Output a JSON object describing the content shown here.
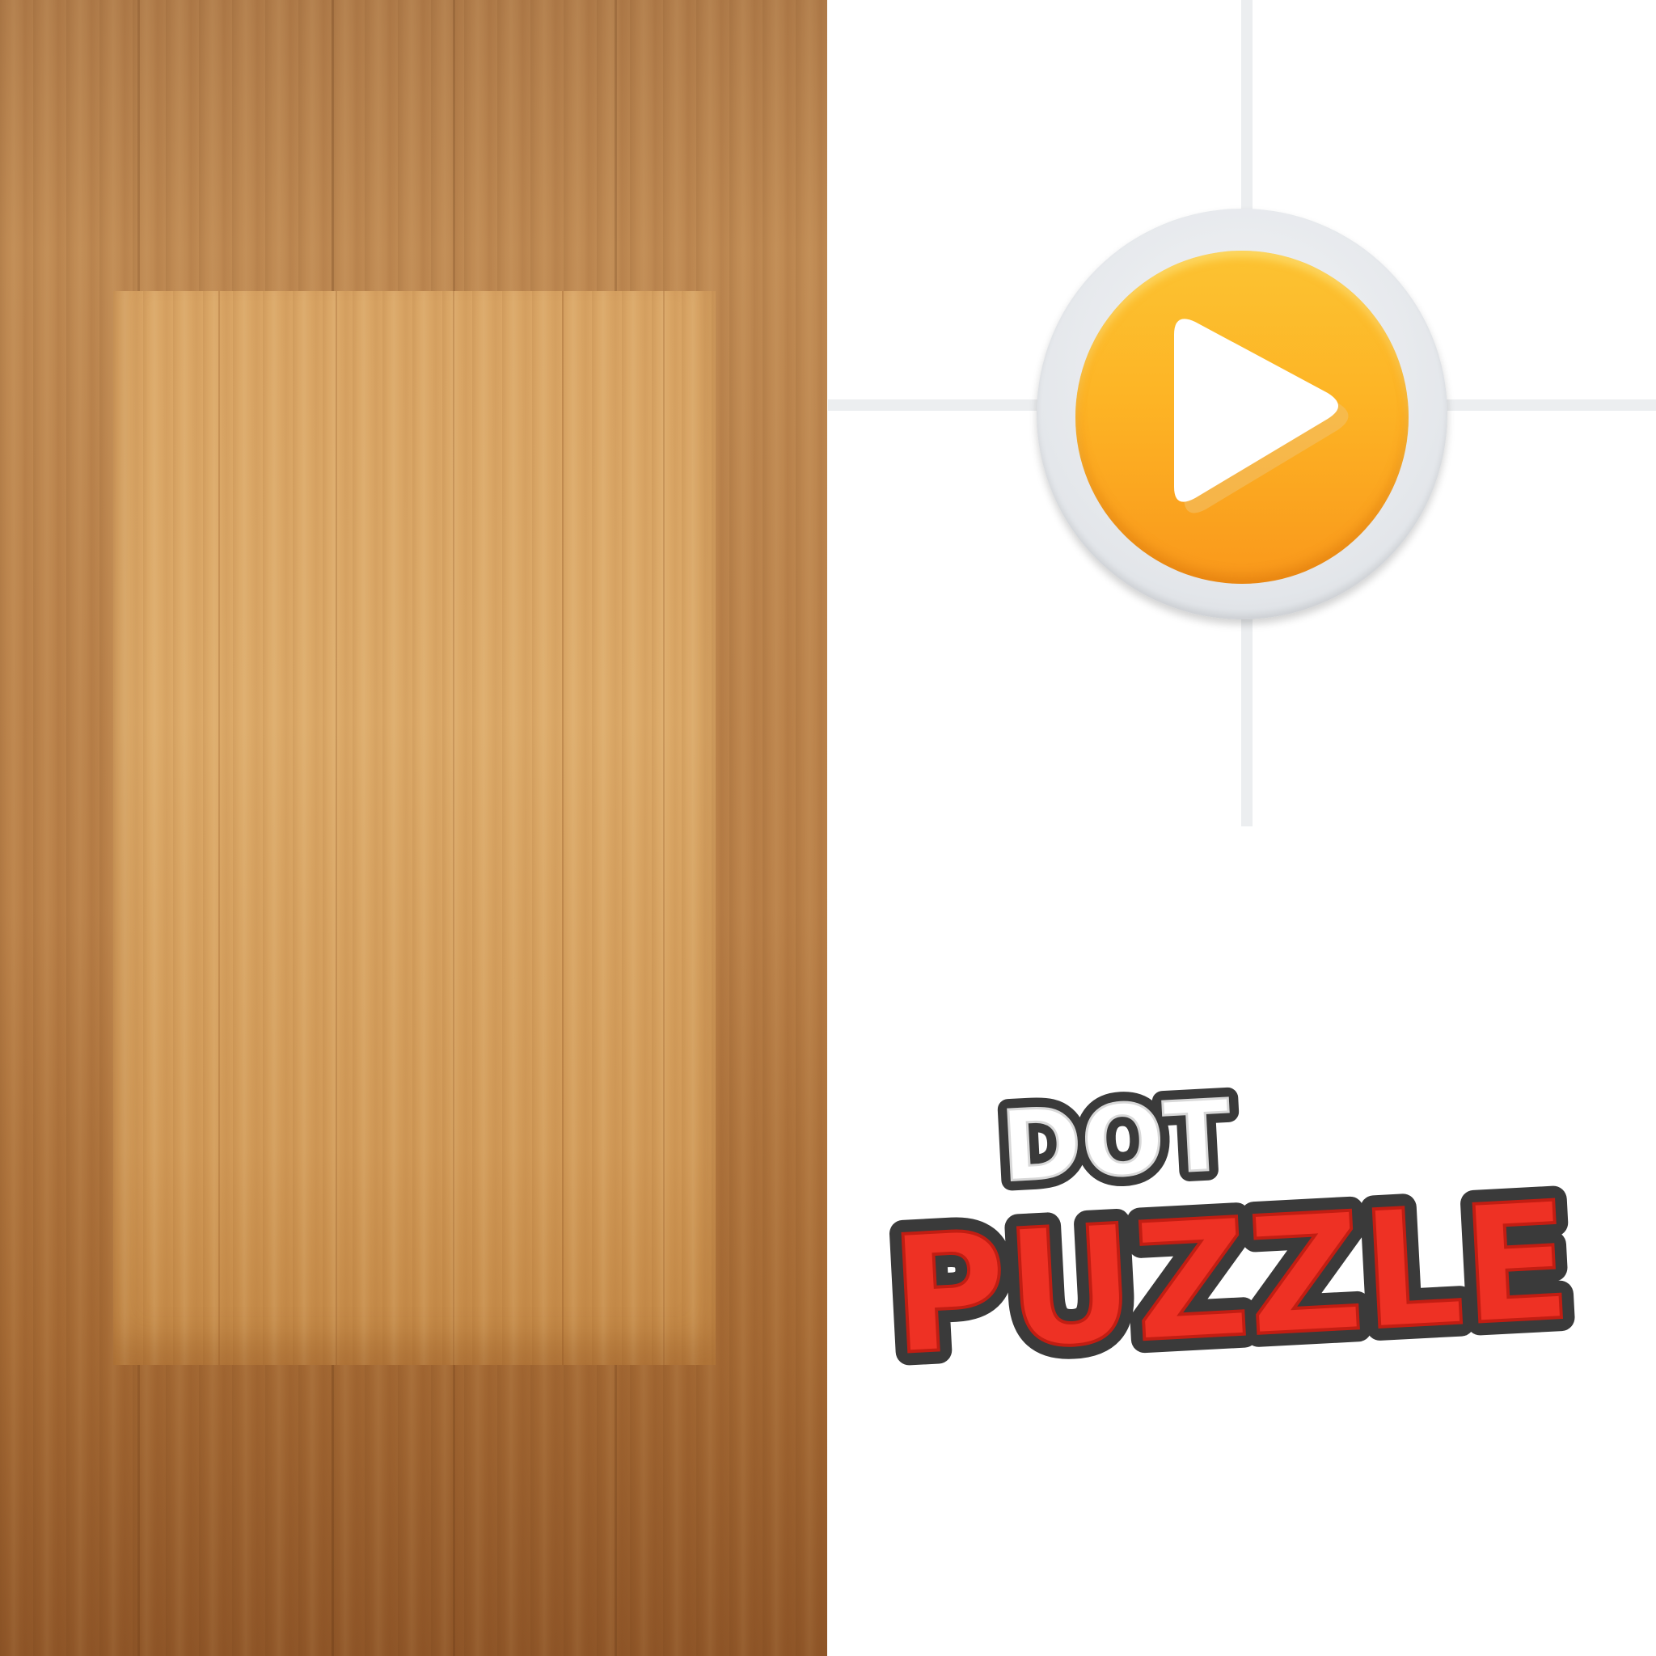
{
  "logo": {
    "line1": "DOT",
    "line2": "PUZZLE"
  },
  "play_button": {
    "icon": "play-icon"
  },
  "colors": {
    "wood_dark": "#a66b35",
    "wood_light": "#dcaa69",
    "grid_line": "#eceef0",
    "button_gold": "#fdb425",
    "button_ring": "#e3e6ea",
    "logo_red": "#ee3124",
    "logo_white": "#ffffff",
    "logo_outline": "#3a3a3a"
  }
}
